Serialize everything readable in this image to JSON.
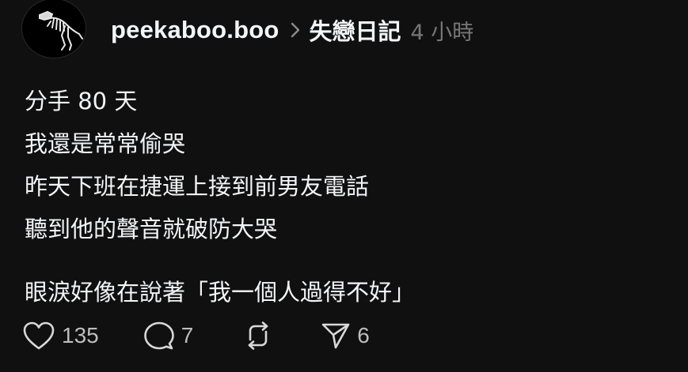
{
  "post": {
    "author": "peekaboo.boo",
    "topic": "失戀日記",
    "time": "4 小時",
    "lines": [
      "分手 80 天",
      "我還是常常偷哭",
      "昨天下班在捷運上接到前男友電話",
      "聽到他的聲音就破防大哭"
    ],
    "last_line": "眼淚好像在說著「我一個人過得不好」"
  },
  "actions": {
    "likes": "135",
    "replies": "7",
    "shares": "6"
  },
  "icons": {
    "avatar": "dinosaur-skeleton-avatar",
    "separator": "chevron-right-icon",
    "like": "heart-icon",
    "reply": "speech-bubble-icon",
    "repost": "repost-icon",
    "share": "send-icon"
  },
  "colors": {
    "background": "#101010",
    "text": "#f3f5f7",
    "muted": "#777777",
    "count": "#bdbdbd"
  }
}
